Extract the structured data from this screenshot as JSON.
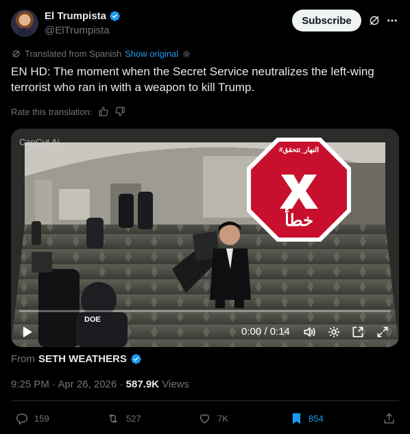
{
  "author": {
    "name": "El Trumpista",
    "handle": "@ElTrumpista",
    "verified": true,
    "avatar_icon": "avatar-photo"
  },
  "header": {
    "subscribe_label": "Subscribe",
    "grok_icon": "grok-icon",
    "more_icon": "more-icon"
  },
  "translation": {
    "label": "Translated from Spanish",
    "show_original": "Show original",
    "rate_label": "Rate this translation:"
  },
  "post": {
    "text": "EN HD: The moment when the Secret Service neutralizes the left-wing terrorist who ran in with a weapon to kill Trump."
  },
  "video": {
    "watermark": "CapCut Ai",
    "overlay_top_text": "#النهار_تتحقق",
    "overlay_bottom_text": "خطأ",
    "overlay_color": "#c8102e",
    "time": "0:00 / 0:14",
    "agent_patch": "DOE"
  },
  "attribution": {
    "from_label": "From",
    "from_name": "SETH WEATHERS"
  },
  "meta": {
    "time": "9:25 PM",
    "dot1": "·",
    "date": "Apr 26, 2026",
    "dot2": "·",
    "views_count": "587.9K",
    "views_label": "Views"
  },
  "actions": {
    "replies": "159",
    "reposts": "527",
    "likes": "7K",
    "bookmarks": "854"
  },
  "colors": {
    "accent": "#1d9bf0",
    "text": "#e7e9ea",
    "muted": "#71767b",
    "background": "#000000"
  }
}
